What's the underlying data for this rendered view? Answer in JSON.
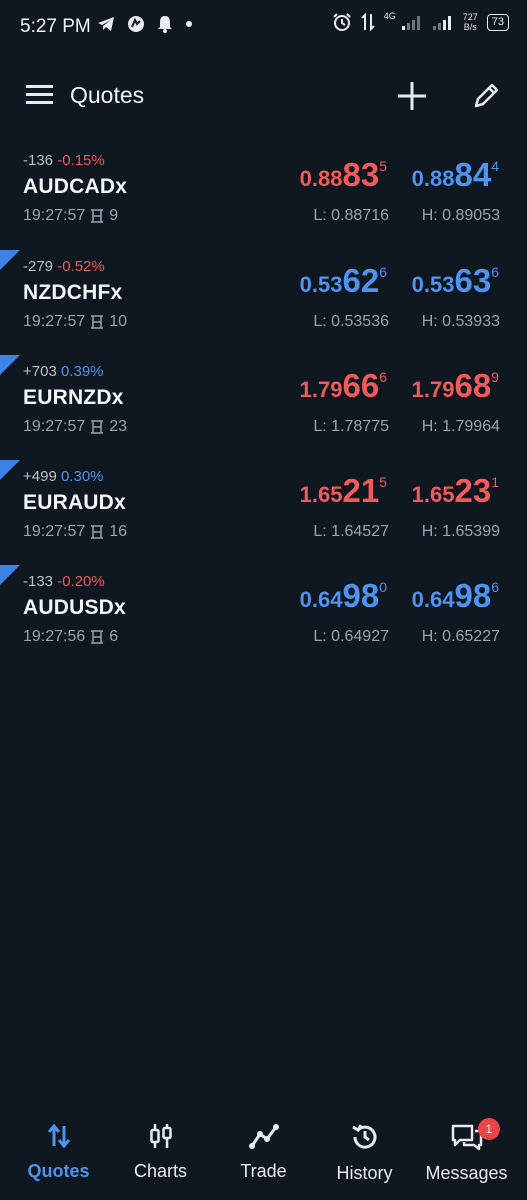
{
  "status_bar": {
    "time": "5:27 PM",
    "network_type": "4G",
    "net_speed_value": "727",
    "net_speed_unit": "B/s",
    "battery": "73"
  },
  "header": {
    "title": "Quotes"
  },
  "colors": {
    "background": "#0f1720",
    "down": "#f05a5a",
    "up": "#4f93ef",
    "accent": "#3d82e6",
    "muted": "#9aa3ad"
  },
  "quotes": [
    {
      "change_points": "-136",
      "change_percent": "-0.15%",
      "direction": "down",
      "symbol": "AUDCADx",
      "time": "19:27:57",
      "spread": "9",
      "bid": {
        "prefix": "0.88",
        "big": "83",
        "sup": "5",
        "color": "red"
      },
      "ask": {
        "prefix": "0.88",
        "big": "84",
        "sup": "4",
        "color": "blue"
      },
      "low": "L: 0.88716",
      "high": "H: 0.89053",
      "marker": false
    },
    {
      "change_points": "-279",
      "change_percent": "-0.52%",
      "direction": "down",
      "symbol": "NZDCHFx",
      "time": "19:27:57",
      "spread": "10",
      "bid": {
        "prefix": "0.53",
        "big": "62",
        "sup": "6",
        "color": "blue"
      },
      "ask": {
        "prefix": "0.53",
        "big": "63",
        "sup": "6",
        "color": "blue"
      },
      "low": "L: 0.53536",
      "high": "H: 0.53933",
      "marker": true
    },
    {
      "change_points": "+703",
      "change_percent": "0.39%",
      "direction": "up",
      "symbol": "EURNZDx",
      "time": "19:27:57",
      "spread": "23",
      "bid": {
        "prefix": "1.79",
        "big": "66",
        "sup": "6",
        "color": "red"
      },
      "ask": {
        "prefix": "1.79",
        "big": "68",
        "sup": "9",
        "color": "red"
      },
      "low": "L: 1.78775",
      "high": "H: 1.79964",
      "marker": true
    },
    {
      "change_points": "+499",
      "change_percent": "0.30%",
      "direction": "up",
      "symbol": "EURAUDx",
      "time": "19:27:57",
      "spread": "16",
      "bid": {
        "prefix": "1.65",
        "big": "21",
        "sup": "5",
        "color": "red"
      },
      "ask": {
        "prefix": "1.65",
        "big": "23",
        "sup": "1",
        "color": "red"
      },
      "low": "L: 1.64527",
      "high": "H: 1.65399",
      "marker": true
    },
    {
      "change_points": "-133",
      "change_percent": "-0.20%",
      "direction": "down",
      "symbol": "AUDUSDx",
      "time": "19:27:56",
      "spread": "6",
      "bid": {
        "prefix": "0.64",
        "big": "98",
        "sup": "0",
        "color": "blue"
      },
      "ask": {
        "prefix": "0.64",
        "big": "98",
        "sup": "6",
        "color": "blue"
      },
      "low": "L: 0.64927",
      "high": "H: 0.65227",
      "marker": true
    }
  ],
  "nav": {
    "items": [
      {
        "label": "Quotes",
        "icon": "quotes-arrows-icon",
        "active": true
      },
      {
        "label": "Charts",
        "icon": "candlestick-icon",
        "active": false
      },
      {
        "label": "Trade",
        "icon": "trade-line-icon",
        "active": false
      },
      {
        "label": "History",
        "icon": "history-clock-icon",
        "active": false
      },
      {
        "label": "Messages",
        "icon": "messages-icon",
        "active": false
      }
    ],
    "messages_badge": "1"
  }
}
